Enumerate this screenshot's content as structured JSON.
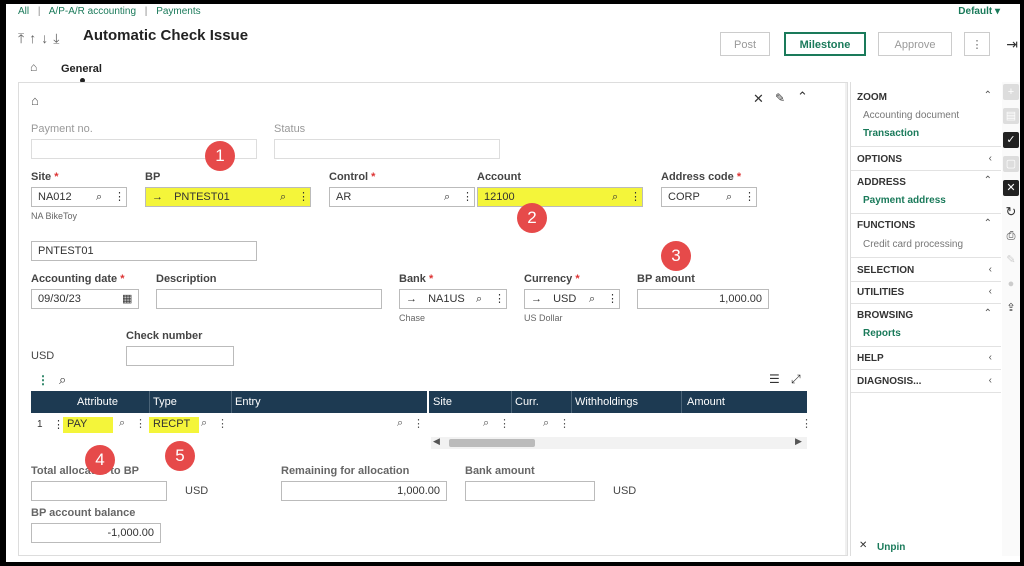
{
  "breadcrumb": [
    "All",
    "A/P-A/R accounting",
    "Payments"
  ],
  "breadcrumb_sep": "|",
  "header": {
    "default_label": "Default",
    "title": "Automatic Check Issue",
    "buttons": {
      "post": "Post",
      "milestone": "Milestone",
      "approve": "Approve"
    }
  },
  "tabs": {
    "general": "General"
  },
  "form": {
    "payment_no_label": "Payment no.",
    "status_label": "Status",
    "site_label": "Site",
    "site_value": "NA012",
    "site_desc": "NA BikeToy",
    "bp_label": "BP",
    "bp_value": "PNTEST01",
    "control_label": "Control",
    "control_value": "AR",
    "account_label": "Account",
    "account_value": "12100",
    "address_code_label": "Address code",
    "address_code_value": "CORP",
    "bp_name_value": "PNTEST01",
    "accounting_date_label": "Accounting date",
    "accounting_date_value": "09/30/23",
    "description_label": "Description",
    "bank_label": "Bank",
    "bank_value": "NA1US",
    "bank_desc": "Chase",
    "currency_label": "Currency",
    "currency_value": "USD",
    "currency_desc": "US Dollar",
    "bp_amount_label": "BP amount",
    "bp_amount_value": "1,000.00",
    "check_number_label": "Check number",
    "usd_text": "USD",
    "total_allocated_label": "Total allocated to BP",
    "total_allocated_currency": "USD",
    "remaining_label": "Remaining for allocation",
    "remaining_value": "1,000.00",
    "bank_amount_label": "Bank amount",
    "bank_amount_currency": "USD",
    "bp_balance_label": "BP account balance",
    "bp_balance_value": "-1,000.00"
  },
  "grid": {
    "columns": [
      "Attribute",
      "Type",
      "Entry",
      "Site",
      "Curr.",
      "Withholdings",
      "Amount"
    ],
    "rows": [
      {
        "num": "1",
        "attribute": "PAY",
        "type": "RECPT"
      }
    ]
  },
  "markers": [
    "1",
    "2",
    "3",
    "4",
    "5"
  ],
  "side_panel": {
    "zoom": {
      "label": "ZOOM",
      "items": [
        "Accounting document",
        "Transaction"
      ]
    },
    "options": "OPTIONS",
    "address": {
      "label": "ADDRESS",
      "items": [
        "Payment address"
      ]
    },
    "functions": {
      "label": "FUNCTIONS",
      "items": [
        "Credit card processing"
      ]
    },
    "selection": "SELECTION",
    "utilities": "UTILITIES",
    "browsing": {
      "label": "BROWSING",
      "items": [
        "Reports"
      ]
    },
    "help": "HELP",
    "diagnosis": "DIAGNOSIS...",
    "unpin": "Unpin"
  },
  "colors": {
    "accent": "#1a7a5a",
    "highlight": "#f4f53a",
    "marker": "#e64a4a",
    "grid_header": "#1d3a52"
  }
}
